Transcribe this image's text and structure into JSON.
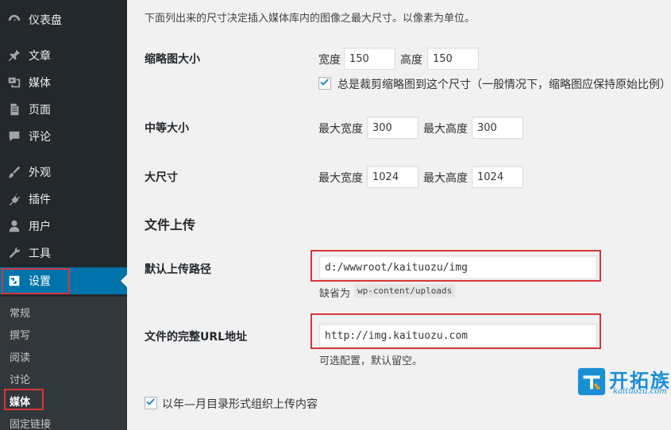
{
  "sidebar": {
    "items": [
      {
        "label": "仪表盘",
        "icon": "dashboard-icon"
      },
      {
        "label": "文章",
        "icon": "pin-icon"
      },
      {
        "label": "媒体",
        "icon": "media-icon"
      },
      {
        "label": "页面",
        "icon": "page-icon"
      },
      {
        "label": "评论",
        "icon": "comment-icon"
      },
      {
        "label": "外观",
        "icon": "brush-icon"
      },
      {
        "label": "插件",
        "icon": "plugin-icon"
      },
      {
        "label": "用户",
        "icon": "user-icon"
      },
      {
        "label": "工具",
        "icon": "wrench-icon"
      },
      {
        "label": "设置",
        "icon": "settings-icon"
      }
    ],
    "submenu": [
      "常规",
      "撰写",
      "阅读",
      "讨论",
      "媒体",
      "固定链接"
    ],
    "active_color": "#0073aa"
  },
  "content": {
    "intro": "下面列出来的尺寸决定插入媒体库内的图像之最大尺寸。以像素为单位。",
    "thumbnail": {
      "label": "缩略图大小",
      "width_label": "宽度",
      "width": "150",
      "height_label": "高度",
      "height": "150",
      "crop_label": "总是裁剪缩略图到这个尺寸（一般情况下，缩略图应保持原始比例）"
    },
    "medium": {
      "label": "中等大小",
      "width_label": "最大宽度",
      "width": "300",
      "height_label": "最大高度",
      "height": "300"
    },
    "large": {
      "label": "大尺寸",
      "width_label": "最大宽度",
      "width": "1024",
      "height_label": "最大高度",
      "height": "1024"
    },
    "uploads_heading": "文件上传",
    "upload_path": {
      "label": "默认上传路径",
      "value": "d:/wwwroot/kaituozu/img",
      "hint_prefix": "缺省为",
      "hint_code": "wp-content/uploads"
    },
    "upload_url": {
      "label": "文件的完整URL地址",
      "value": "http://img.kaituozu.com",
      "hint": "可选配置，默认留空。"
    },
    "year_month_label": "以年—月目录形式组织上传内容"
  },
  "watermark": {
    "title": "开拓族",
    "subtitle": "kaituozu.com",
    "color": "#1a8fd6"
  },
  "highlight_color": "#d63638"
}
